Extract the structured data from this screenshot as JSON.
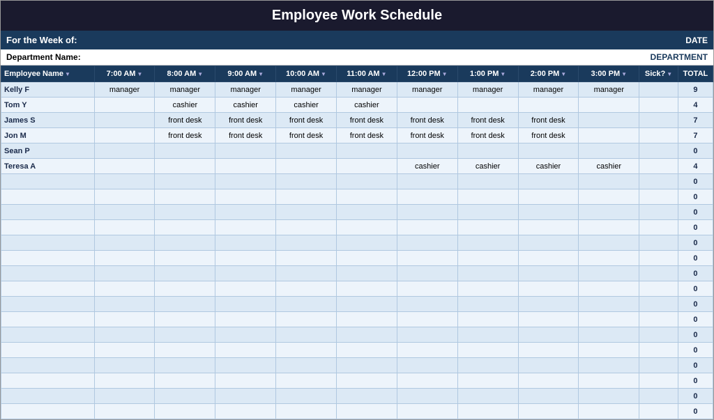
{
  "title": "Employee Work Schedule",
  "meta": {
    "for_week_label": "For the Week of:",
    "date_label": "DATE",
    "dept_name_label": "Department Name:",
    "dept_label": "DEPARTMENT"
  },
  "columns": {
    "employee_name": "Employee Name",
    "times": [
      "7:00 AM",
      "8:00 AM",
      "9:00 AM",
      "10:00 AM",
      "11:00 AM",
      "12:00 PM",
      "1:00 PM",
      "2:00 PM",
      "3:00 PM"
    ],
    "sick": "Sick?",
    "total": "TOTAL"
  },
  "employees": [
    {
      "name": "Kelly F",
      "slots": [
        "manager",
        "manager",
        "manager",
        "manager",
        "manager",
        "manager",
        "manager",
        "manager",
        "manager"
      ],
      "sick": "",
      "total": "9"
    },
    {
      "name": "Tom Y",
      "slots": [
        "",
        "cashier",
        "cashier",
        "cashier",
        "cashier",
        "",
        "",
        "",
        ""
      ],
      "sick": "",
      "total": "4"
    },
    {
      "name": "James S",
      "slots": [
        "",
        "front desk",
        "front desk",
        "front desk",
        "front desk",
        "front desk",
        "front desk",
        "front desk",
        ""
      ],
      "sick": "",
      "total": "7"
    },
    {
      "name": "Jon M",
      "slots": [
        "",
        "front desk",
        "front desk",
        "front desk",
        "front desk",
        "front desk",
        "front desk",
        "front desk",
        ""
      ],
      "sick": "",
      "total": "7"
    },
    {
      "name": "Sean P",
      "slots": [
        "",
        "",
        "",
        "",
        "",
        "",
        "",
        "",
        ""
      ],
      "sick": "",
      "total": "0"
    },
    {
      "name": "Teresa A",
      "slots": [
        "",
        "",
        "",
        "",
        "",
        "cashier",
        "cashier",
        "cashier",
        "cashier"
      ],
      "sick": "",
      "total": "4"
    },
    {
      "name": "",
      "slots": [
        "",
        "",
        "",
        "",
        "",
        "",
        "",
        "",
        ""
      ],
      "sick": "",
      "total": "0"
    },
    {
      "name": "",
      "slots": [
        "",
        "",
        "",
        "",
        "",
        "",
        "",
        "",
        ""
      ],
      "sick": "",
      "total": "0"
    },
    {
      "name": "",
      "slots": [
        "",
        "",
        "",
        "",
        "",
        "",
        "",
        "",
        ""
      ],
      "sick": "",
      "total": "0"
    },
    {
      "name": "",
      "slots": [
        "",
        "",
        "",
        "",
        "",
        "",
        "",
        "",
        ""
      ],
      "sick": "",
      "total": "0"
    },
    {
      "name": "",
      "slots": [
        "",
        "",
        "",
        "",
        "",
        "",
        "",
        "",
        ""
      ],
      "sick": "",
      "total": "0"
    },
    {
      "name": "",
      "slots": [
        "",
        "",
        "",
        "",
        "",
        "",
        "",
        "",
        ""
      ],
      "sick": "",
      "total": "0"
    },
    {
      "name": "",
      "slots": [
        "",
        "",
        "",
        "",
        "",
        "",
        "",
        "",
        ""
      ],
      "sick": "",
      "total": "0"
    },
    {
      "name": "",
      "slots": [
        "",
        "",
        "",
        "",
        "",
        "",
        "",
        "",
        ""
      ],
      "sick": "",
      "total": "0"
    },
    {
      "name": "",
      "slots": [
        "",
        "",
        "",
        "",
        "",
        "",
        "",
        "",
        ""
      ],
      "sick": "",
      "total": "0"
    },
    {
      "name": "",
      "slots": [
        "",
        "",
        "",
        "",
        "",
        "",
        "",
        "",
        ""
      ],
      "sick": "",
      "total": "0"
    },
    {
      "name": "",
      "slots": [
        "",
        "",
        "",
        "",
        "",
        "",
        "",
        "",
        ""
      ],
      "sick": "",
      "total": "0"
    },
    {
      "name": "",
      "slots": [
        "",
        "",
        "",
        "",
        "",
        "",
        "",
        "",
        ""
      ],
      "sick": "",
      "total": "0"
    },
    {
      "name": "",
      "slots": [
        "",
        "",
        "",
        "",
        "",
        "",
        "",
        "",
        ""
      ],
      "sick": "",
      "total": "0"
    },
    {
      "name": "",
      "slots": [
        "",
        "",
        "",
        "",
        "",
        "",
        "",
        "",
        ""
      ],
      "sick": "",
      "total": "0"
    },
    {
      "name": "",
      "slots": [
        "",
        "",
        "",
        "",
        "",
        "",
        "",
        "",
        ""
      ],
      "sick": "",
      "total": "0"
    },
    {
      "name": "",
      "slots": [
        "",
        "",
        "",
        "",
        "",
        "",
        "",
        "",
        ""
      ],
      "sick": "",
      "total": "0"
    }
  ]
}
